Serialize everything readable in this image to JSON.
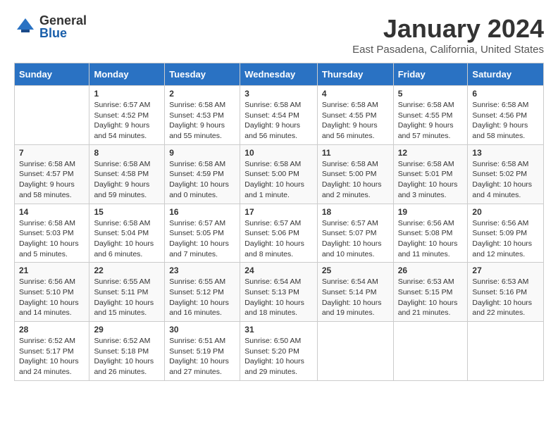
{
  "logo": {
    "general": "General",
    "blue": "Blue"
  },
  "title": "January 2024",
  "subtitle": "East Pasadena, California, United States",
  "days_of_week": [
    "Sunday",
    "Monday",
    "Tuesday",
    "Wednesday",
    "Thursday",
    "Friday",
    "Saturday"
  ],
  "weeks": [
    [
      {
        "day": "",
        "info": ""
      },
      {
        "day": "1",
        "info": "Sunrise: 6:57 AM\nSunset: 4:52 PM\nDaylight: 9 hours\nand 54 minutes."
      },
      {
        "day": "2",
        "info": "Sunrise: 6:58 AM\nSunset: 4:53 PM\nDaylight: 9 hours\nand 55 minutes."
      },
      {
        "day": "3",
        "info": "Sunrise: 6:58 AM\nSunset: 4:54 PM\nDaylight: 9 hours\nand 56 minutes."
      },
      {
        "day": "4",
        "info": "Sunrise: 6:58 AM\nSunset: 4:55 PM\nDaylight: 9 hours\nand 56 minutes."
      },
      {
        "day": "5",
        "info": "Sunrise: 6:58 AM\nSunset: 4:55 PM\nDaylight: 9 hours\nand 57 minutes."
      },
      {
        "day": "6",
        "info": "Sunrise: 6:58 AM\nSunset: 4:56 PM\nDaylight: 9 hours\nand 58 minutes."
      }
    ],
    [
      {
        "day": "7",
        "info": "Sunrise: 6:58 AM\nSunset: 4:57 PM\nDaylight: 9 hours\nand 58 minutes."
      },
      {
        "day": "8",
        "info": "Sunrise: 6:58 AM\nSunset: 4:58 PM\nDaylight: 9 hours\nand 59 minutes."
      },
      {
        "day": "9",
        "info": "Sunrise: 6:58 AM\nSunset: 4:59 PM\nDaylight: 10 hours\nand 0 minutes."
      },
      {
        "day": "10",
        "info": "Sunrise: 6:58 AM\nSunset: 5:00 PM\nDaylight: 10 hours\nand 1 minute."
      },
      {
        "day": "11",
        "info": "Sunrise: 6:58 AM\nSunset: 5:00 PM\nDaylight: 10 hours\nand 2 minutes."
      },
      {
        "day": "12",
        "info": "Sunrise: 6:58 AM\nSunset: 5:01 PM\nDaylight: 10 hours\nand 3 minutes."
      },
      {
        "day": "13",
        "info": "Sunrise: 6:58 AM\nSunset: 5:02 PM\nDaylight: 10 hours\nand 4 minutes."
      }
    ],
    [
      {
        "day": "14",
        "info": "Sunrise: 6:58 AM\nSunset: 5:03 PM\nDaylight: 10 hours\nand 5 minutes."
      },
      {
        "day": "15",
        "info": "Sunrise: 6:58 AM\nSunset: 5:04 PM\nDaylight: 10 hours\nand 6 minutes."
      },
      {
        "day": "16",
        "info": "Sunrise: 6:57 AM\nSunset: 5:05 PM\nDaylight: 10 hours\nand 7 minutes."
      },
      {
        "day": "17",
        "info": "Sunrise: 6:57 AM\nSunset: 5:06 PM\nDaylight: 10 hours\nand 8 minutes."
      },
      {
        "day": "18",
        "info": "Sunrise: 6:57 AM\nSunset: 5:07 PM\nDaylight: 10 hours\nand 10 minutes."
      },
      {
        "day": "19",
        "info": "Sunrise: 6:56 AM\nSunset: 5:08 PM\nDaylight: 10 hours\nand 11 minutes."
      },
      {
        "day": "20",
        "info": "Sunrise: 6:56 AM\nSunset: 5:09 PM\nDaylight: 10 hours\nand 12 minutes."
      }
    ],
    [
      {
        "day": "21",
        "info": "Sunrise: 6:56 AM\nSunset: 5:10 PM\nDaylight: 10 hours\nand 14 minutes."
      },
      {
        "day": "22",
        "info": "Sunrise: 6:55 AM\nSunset: 5:11 PM\nDaylight: 10 hours\nand 15 minutes."
      },
      {
        "day": "23",
        "info": "Sunrise: 6:55 AM\nSunset: 5:12 PM\nDaylight: 10 hours\nand 16 minutes."
      },
      {
        "day": "24",
        "info": "Sunrise: 6:54 AM\nSunset: 5:13 PM\nDaylight: 10 hours\nand 18 minutes."
      },
      {
        "day": "25",
        "info": "Sunrise: 6:54 AM\nSunset: 5:14 PM\nDaylight: 10 hours\nand 19 minutes."
      },
      {
        "day": "26",
        "info": "Sunrise: 6:53 AM\nSunset: 5:15 PM\nDaylight: 10 hours\nand 21 minutes."
      },
      {
        "day": "27",
        "info": "Sunrise: 6:53 AM\nSunset: 5:16 PM\nDaylight: 10 hours\nand 22 minutes."
      }
    ],
    [
      {
        "day": "28",
        "info": "Sunrise: 6:52 AM\nSunset: 5:17 PM\nDaylight: 10 hours\nand 24 minutes."
      },
      {
        "day": "29",
        "info": "Sunrise: 6:52 AM\nSunset: 5:18 PM\nDaylight: 10 hours\nand 26 minutes."
      },
      {
        "day": "30",
        "info": "Sunrise: 6:51 AM\nSunset: 5:19 PM\nDaylight: 10 hours\nand 27 minutes."
      },
      {
        "day": "31",
        "info": "Sunrise: 6:50 AM\nSunset: 5:20 PM\nDaylight: 10 hours\nand 29 minutes."
      },
      {
        "day": "",
        "info": ""
      },
      {
        "day": "",
        "info": ""
      },
      {
        "day": "",
        "info": ""
      }
    ]
  ]
}
